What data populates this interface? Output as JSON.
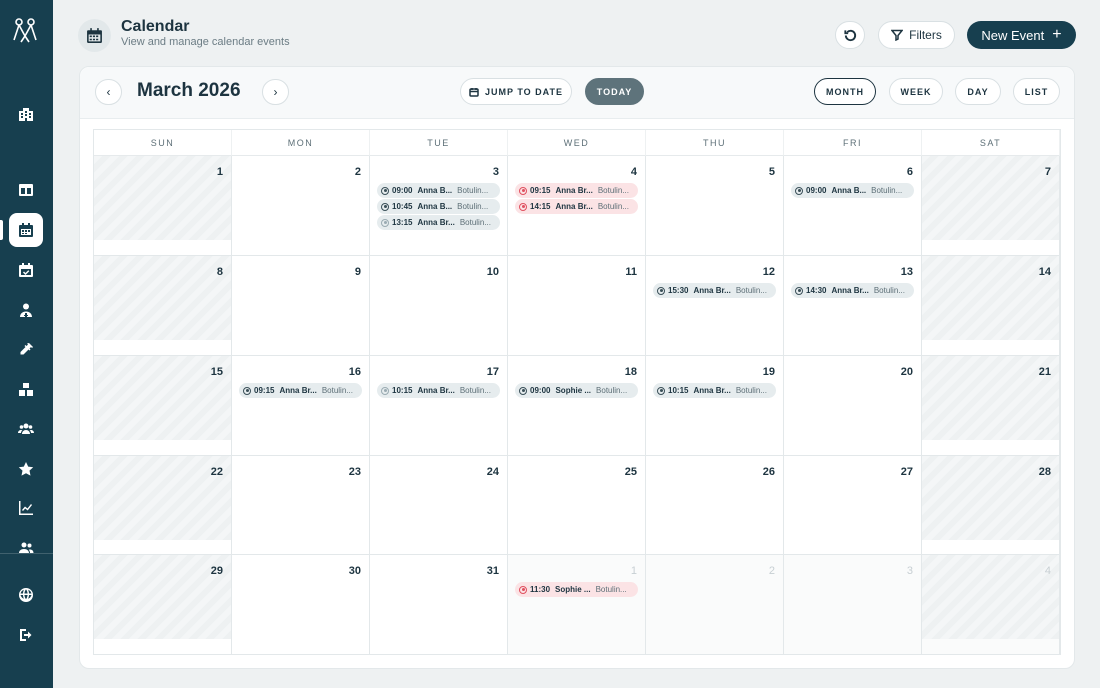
{
  "header": {
    "title": "Calendar",
    "subtitle": "View and manage calendar events",
    "filters_label": "Filters",
    "new_event_label": "New Event",
    "new_event_icon": "plus-icon"
  },
  "sidebar": {
    "items": [
      {
        "icon": "building-icon",
        "active": false
      },
      {
        "icon": "layout-icon",
        "active": false
      },
      {
        "icon": "calendar-icon",
        "active": true
      },
      {
        "icon": "calendar-check-icon",
        "active": false
      },
      {
        "icon": "user-doctor-icon",
        "active": false
      },
      {
        "icon": "syringe-icon",
        "active": false
      },
      {
        "icon": "boxes-icon",
        "active": false
      },
      {
        "icon": "users-icon",
        "active": false
      },
      {
        "icon": "star-icon",
        "active": false
      },
      {
        "icon": "chart-line-icon",
        "active": false
      },
      {
        "icon": "users-gear-icon",
        "active": false
      },
      {
        "icon": "globe-icon",
        "active": false
      },
      {
        "icon": "logout-icon",
        "active": false
      }
    ]
  },
  "toolbar": {
    "prev_label": "‹",
    "next_label": "›",
    "month_title": "March 2026",
    "jump_label": "JUMP TO DATE",
    "today_label": "TODAY",
    "views": [
      "MONTH",
      "WEEK",
      "DAY",
      "LIST"
    ],
    "active_view": "MONTH"
  },
  "calendar": {
    "weekdays": [
      "SUN",
      "MON",
      "TUE",
      "WED",
      "THU",
      "FRI",
      "SAT"
    ],
    "weeks": [
      [
        {
          "day": "1"
        },
        {
          "day": "2"
        },
        {
          "day": "3",
          "events": [
            {
              "time": "09:00",
              "who": "Anna B...",
              "what": "Botulin...",
              "color": "gray"
            },
            {
              "time": "10:45",
              "who": "Anna B...",
              "what": "Botulin...",
              "color": "gray"
            },
            {
              "time": "13:15",
              "who": "Anna Br...",
              "what": "Botulin...",
              "color": "faint"
            }
          ]
        },
        {
          "day": "4",
          "events": [
            {
              "time": "09:15",
              "who": "Anna Br...",
              "what": "Botulin...",
              "color": "red"
            },
            {
              "time": "14:15",
              "who": "Anna Br...",
              "what": "Botulin...",
              "color": "red"
            }
          ]
        },
        {
          "day": "5"
        },
        {
          "day": "6",
          "events": [
            {
              "time": "09:00",
              "who": "Anna B...",
              "what": "Botulin...",
              "color": "gray"
            }
          ]
        },
        {
          "day": "7"
        }
      ],
      [
        {
          "day": "8"
        },
        {
          "day": "9"
        },
        {
          "day": "10"
        },
        {
          "day": "11"
        },
        {
          "day": "12",
          "events": [
            {
              "time": "15:30",
              "who": "Anna Br...",
              "what": "Botulin...",
              "color": "gray"
            }
          ]
        },
        {
          "day": "13",
          "events": [
            {
              "time": "14:30",
              "who": "Anna Br...",
              "what": "Botulin...",
              "color": "gray"
            }
          ]
        },
        {
          "day": "14"
        }
      ],
      [
        {
          "day": "15"
        },
        {
          "day": "16",
          "events": [
            {
              "time": "09:15",
              "who": "Anna Br...",
              "what": "Botulin...",
              "color": "gray"
            }
          ]
        },
        {
          "day": "17",
          "events": [
            {
              "time": "10:15",
              "who": "Anna Br...",
              "what": "Botulin...",
              "color": "faint"
            }
          ]
        },
        {
          "day": "18",
          "events": [
            {
              "time": "09:00",
              "who": "Sophie ...",
              "what": "Botulin...",
              "color": "gray"
            }
          ]
        },
        {
          "day": "19",
          "events": [
            {
              "time": "10:15",
              "who": "Anna Br...",
              "what": "Botulin...",
              "color": "gray"
            }
          ]
        },
        {
          "day": "20"
        },
        {
          "day": "21"
        }
      ],
      [
        {
          "day": "22"
        },
        {
          "day": "23"
        },
        {
          "day": "24"
        },
        {
          "day": "25"
        },
        {
          "day": "26"
        },
        {
          "day": "27"
        },
        {
          "day": "28"
        }
      ],
      [
        {
          "day": "29"
        },
        {
          "day": "30"
        },
        {
          "day": "31"
        },
        {
          "day": "1",
          "out": true,
          "events": [
            {
              "time": "11:30",
              "who": "Sophie ...",
              "what": "Botulin...",
              "color": "red"
            }
          ]
        },
        {
          "day": "2",
          "out": true
        },
        {
          "day": "3",
          "out": true
        },
        {
          "day": "4",
          "out": true
        }
      ]
    ]
  },
  "colors": {
    "sidebar_bg": "#173f4f",
    "primary": "#173f4f",
    "today_btn": "#5e737b",
    "event_gray": "#e6ecee",
    "event_red": "#fbe3e5",
    "event_red_dot": "#e0505f"
  }
}
